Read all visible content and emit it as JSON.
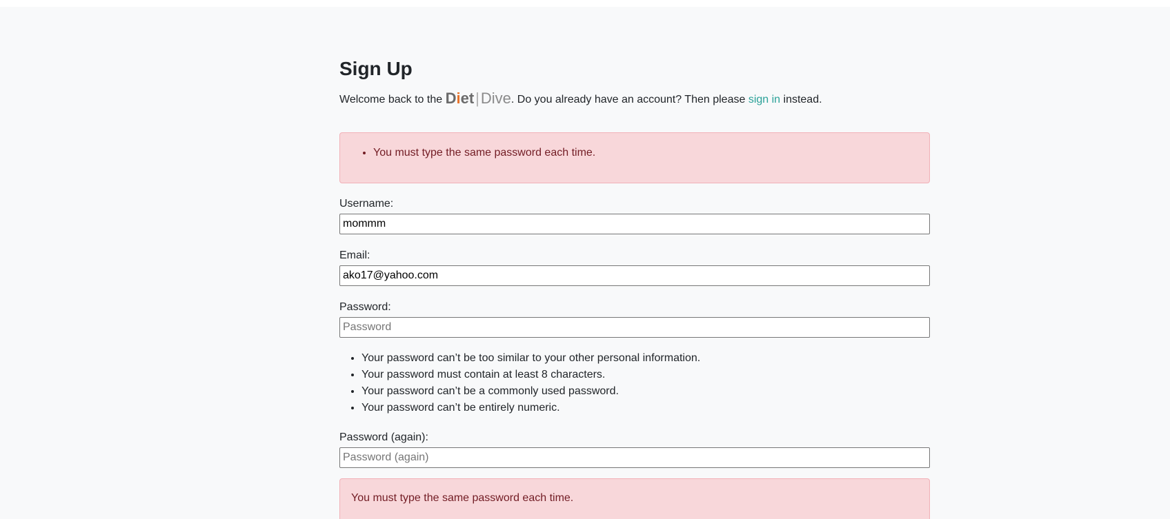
{
  "page": {
    "title": "Sign Up",
    "intro_before": "Welcome back to the ",
    "brand_diet": "Diet",
    "brand_sep": "|",
    "brand_dive": "Dive",
    "intro_middle": ". Do you already have an account? Then please ",
    "signin_link": "sign in",
    "intro_after": " instead."
  },
  "errors": {
    "form_errors": [
      "You must type the same password each time."
    ],
    "password2_error": "You must type the same password each time."
  },
  "form": {
    "username": {
      "label": "Username:",
      "value": "mommm"
    },
    "email": {
      "label": "Email:",
      "value": "ako17@yahoo.com"
    },
    "password1": {
      "label": "Password:",
      "value": "",
      "placeholder": "Password"
    },
    "password2": {
      "label": "Password (again):",
      "value": "",
      "placeholder": "Password (again)"
    },
    "password_help": [
      "Your password can’t be too similar to your other personal information.",
      "Your password must contain at least 8 characters.",
      "Your password can’t be a commonly used password.",
      "Your password can’t be entirely numeric."
    ]
  },
  "colors": {
    "link": "#2aa198",
    "alert_bg": "#f8d7da",
    "alert_text": "#721c24",
    "page_bg": "#f8f9fa",
    "brand_accent": "#e8732a"
  }
}
